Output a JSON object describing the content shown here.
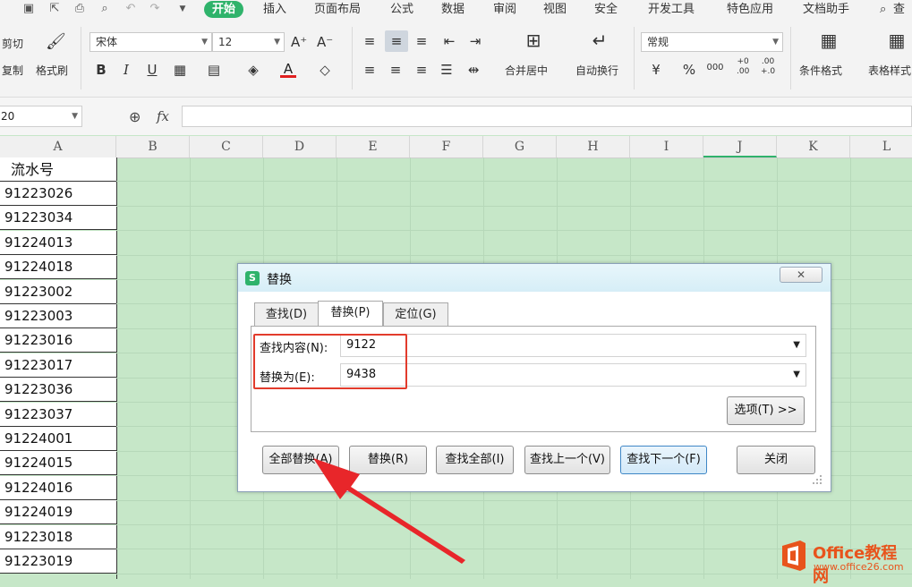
{
  "menubar": {
    "tabs": [
      "开始",
      "插入",
      "页面布局",
      "公式",
      "数据",
      "审阅",
      "视图",
      "安全",
      "开发工具",
      "特色应用",
      "文档助手"
    ],
    "search_label": "查找",
    "accent": "#2fb36b"
  },
  "ribbon": {
    "cut": "剪切",
    "copy": "复制",
    "format_painter": "格式刷",
    "font_name": "宋体",
    "font_size": "12",
    "bold": "B",
    "italic": "I",
    "underline": "U",
    "merge_center": "合并居中",
    "wrap_text": "自动换行",
    "number_format": "常规",
    "percent": "%",
    "thousands": "000",
    "inc_decimal_top": "+0",
    "inc_decimal_bottom": ".00",
    "dec_decimal_top": ".00",
    "dec_decimal_bottom": "+.0",
    "conditional_format": "条件格式",
    "table_style": "表格样式",
    "font_grow": "A⁺",
    "font_shrink": "A⁻",
    "font_color_letter": "A"
  },
  "formula_bar": {
    "name_box": "20",
    "fx": "fx"
  },
  "sheet": {
    "columns": [
      "A",
      "B",
      "C",
      "D",
      "E",
      "F",
      "G",
      "H",
      "I",
      "J",
      "K",
      "L"
    ],
    "header_cell": "流水号",
    "rows": [
      "91223026",
      "91223034",
      "91224013",
      "91224018",
      "91223002",
      "91223003",
      "91223016",
      "91223017",
      "91223036",
      "91223037",
      "91224001",
      "91224015",
      "91224016",
      "91224019",
      "91223018",
      "91223019"
    ]
  },
  "dialog": {
    "logo_letter": "S",
    "title": "替换",
    "close_x": "✕",
    "tabs": [
      "查找(D)",
      "替换(P)",
      "定位(G)"
    ],
    "find_label": "查找内容(N):",
    "find_value": "9122",
    "replace_label": "替换为(E):",
    "replace_value": "9438",
    "options_button": "选项(T) >>",
    "buttons": {
      "replace_all": "全部替换(A)",
      "replace": "替换(R)",
      "find_all": "查找全部(I)",
      "find_prev": "查找上一个(V)",
      "find_next": "查找下一个(F)",
      "close": "关闭"
    }
  },
  "watermark": {
    "line1": "Office教程网",
    "line2": "www.office26.com"
  },
  "colors": {
    "sheet_bg": "#c6e7c8",
    "highlight_red": "#e23b2c",
    "watermark_orange": "#e8541c"
  }
}
